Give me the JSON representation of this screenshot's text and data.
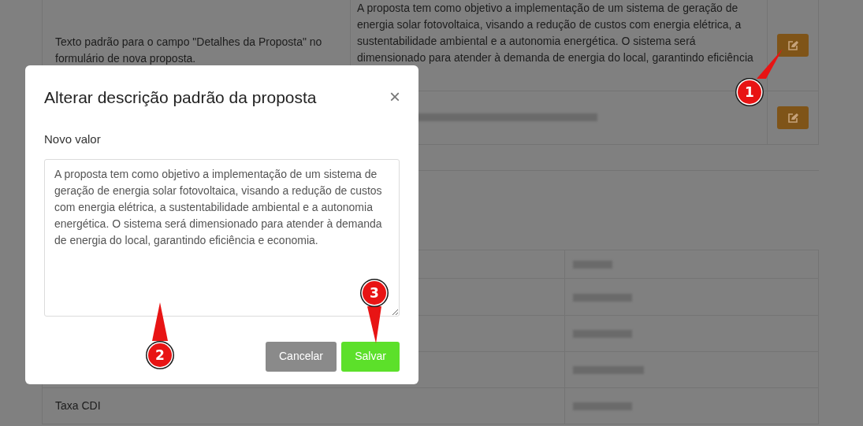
{
  "settings_table": {
    "rows": [
      {
        "label": "Texto padrão para o campo \"Detalhes da Proposta\" no formulário de nova proposta.",
        "value": "A proposta tem como objetivo a implementação de um sistema de geração de energia solar fotovoltaica, visando a redução de custos com energia elétrica, a sustentabilidade ambiental e a autonomia energética. O sistema será dimensionado para atender à demanda de energia do local, garantindo eficiência",
        "redacted": false
      },
      {
        "redacted": true
      }
    ]
  },
  "rates_table": {
    "rows": [
      {
        "redacted": true
      },
      {
        "redacted": true
      },
      {
        "redacted": true
      },
      {
        "redacted": true
      },
      {
        "label": "Taxa CDI",
        "redacted": true
      }
    ]
  },
  "modal": {
    "title": "Alterar descrição padrão da proposta",
    "close": "×",
    "field_label": "Novo valor",
    "value": "A proposta tem como objetivo a implementação de um sistema de geração de energia solar fotovoltaica, visando a redução de custos com energia elétrica, a sustentabilidade ambiental e a autonomia energética. O sistema será dimensionado para atender à demanda de energia do local, garantindo eficiência e economia.",
    "buttons": [
      {
        "label": "Cancelar",
        "kind": "secondary"
      },
      {
        "label": "Salvar",
        "kind": "primary"
      }
    ]
  },
  "callouts": [
    {
      "label": "1"
    },
    {
      "label": "2"
    },
    {
      "label": "3"
    }
  ]
}
